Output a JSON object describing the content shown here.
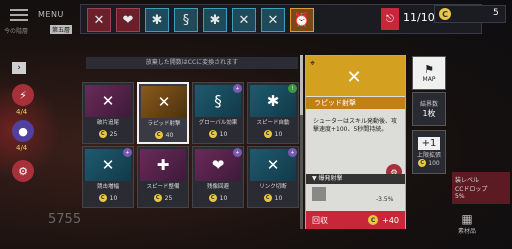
{
  "menu": {
    "label": "MENU",
    "sub": "今の階層",
    "sub_badge": "第五層"
  },
  "topbar": {
    "icons": [
      {
        "name": "rapid-shot-icon",
        "glyph": "✕",
        "tone": "red"
      },
      {
        "name": "heart-icon",
        "glyph": "❤",
        "tone": "red"
      },
      {
        "name": "gear-skill-icon",
        "glyph": "✱",
        "tone": "cyan"
      },
      {
        "name": "swirl-skill-icon",
        "glyph": "§",
        "tone": "cyan"
      },
      {
        "name": "gear-skill-icon",
        "glyph": "✱",
        "tone": "cyan"
      },
      {
        "name": "cross-skill-icon",
        "glyph": "✕",
        "tone": "cyan"
      },
      {
        "name": "blade-skill-icon",
        "glyph": "✕",
        "tone": "cyan"
      },
      {
        "name": "alarm-skill-icon",
        "glyph": "⏰",
        "tone": "orange"
      }
    ],
    "count": "11/10"
  },
  "coins": "5",
  "left": {
    "counts": [
      "4/4",
      "4/4"
    ]
  },
  "bg_number": "5755",
  "panel_header": "放棄した開数はCCに変換されます",
  "cards": [
    {
      "label": "破片追尾",
      "price": "25",
      "tone": "pink",
      "glyph": "✕",
      "badge": ""
    },
    {
      "label": "ラピッド射撃",
      "price": "40",
      "tone": "orng",
      "glyph": "✕",
      "badge": "",
      "selected": true
    },
    {
      "label": "グローバル効果",
      "price": "10",
      "tone": "teal",
      "glyph": "§",
      "badge": "+"
    },
    {
      "label": "スピード自動",
      "price": "10",
      "tone": "teal",
      "glyph": "✱",
      "badge": "!"
    },
    {
      "label": "競击増幅",
      "price": "10",
      "tone": "teal",
      "glyph": "✕",
      "badge": "+"
    },
    {
      "label": "スピード整備",
      "price": "25",
      "tone": "pink",
      "glyph": "✚",
      "badge": ""
    },
    {
      "label": "残像回避",
      "price": "10",
      "tone": "pink",
      "glyph": "❤",
      "badge": "+"
    },
    {
      "label": "リンク切断",
      "price": "10",
      "tone": "teal",
      "glyph": "✕",
      "badge": "+"
    }
  ],
  "detail": {
    "name": "ラピッド射撃",
    "desc": "シューターはスキル発動後、攻撃速度+100、5秒間持続。",
    "tag": "▼ 爆発射撃",
    "sub": "-3.5%",
    "return_label": "回収",
    "return_value": "+40"
  },
  "right": {
    "map": "MAP",
    "floor_label": "結界数",
    "floor_value": "1枚",
    "limit_label": "上限拡張",
    "limit_value": "100"
  },
  "status": {
    "line1": "装レベル",
    "line2": "CCドロップ",
    "line3": "5%"
  },
  "bag": "素材品"
}
